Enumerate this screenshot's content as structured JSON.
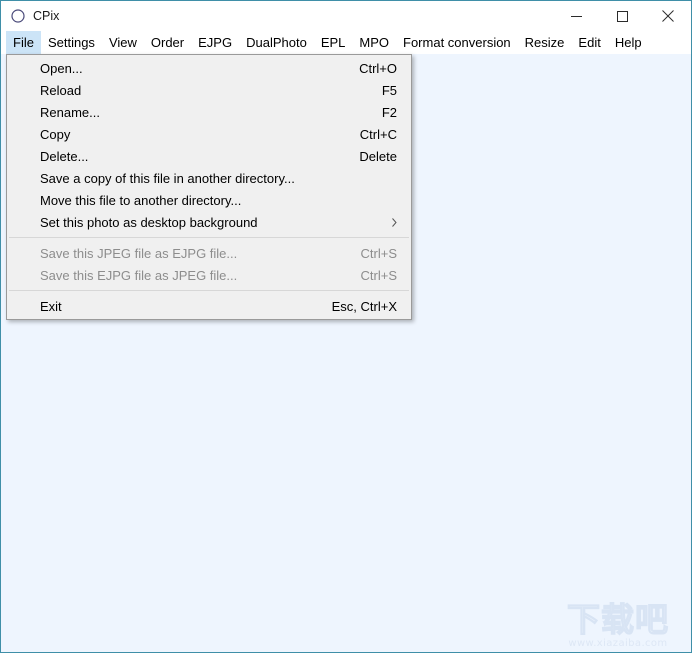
{
  "window": {
    "title": "CPix",
    "icon": "circle-outline-icon",
    "border_color": "#3f8fa8",
    "client_background": "#eef5fe",
    "controls": [
      {
        "name": "minimize",
        "glyph": "minimize-icon"
      },
      {
        "name": "maximize",
        "glyph": "maximize-icon"
      },
      {
        "name": "close",
        "glyph": "close-icon"
      }
    ]
  },
  "menubar": {
    "active_index": 0,
    "highlight_color": "#cce4f7",
    "items": [
      {
        "label": "File"
      },
      {
        "label": "Settings"
      },
      {
        "label": "View"
      },
      {
        "label": "Order"
      },
      {
        "label": "EJPG"
      },
      {
        "label": "DualPhoto"
      },
      {
        "label": "EPL"
      },
      {
        "label": "MPO"
      },
      {
        "label": "Format conversion"
      },
      {
        "label": "Resize"
      },
      {
        "label": "Edit"
      },
      {
        "label": "Help"
      }
    ]
  },
  "file_menu": {
    "background": "#f0f0f0",
    "items": [
      {
        "type": "item",
        "label": "Open...",
        "shortcut": "Ctrl+O",
        "enabled": true,
        "submenu": false
      },
      {
        "type": "item",
        "label": "Reload",
        "shortcut": "F5",
        "enabled": true,
        "submenu": false
      },
      {
        "type": "item",
        "label": "Rename...",
        "shortcut": "F2",
        "enabled": true,
        "submenu": false
      },
      {
        "type": "item",
        "label": "Copy",
        "shortcut": "Ctrl+C",
        "enabled": true,
        "submenu": false
      },
      {
        "type": "item",
        "label": "Delete...",
        "shortcut": "Delete",
        "enabled": true,
        "submenu": false
      },
      {
        "type": "item",
        "label": "Save a copy of this file in another directory...",
        "shortcut": "",
        "enabled": true,
        "submenu": false
      },
      {
        "type": "item",
        "label": "Move this file to another directory...",
        "shortcut": "",
        "enabled": true,
        "submenu": false
      },
      {
        "type": "item",
        "label": "Set this photo as desktop background",
        "shortcut": "",
        "enabled": true,
        "submenu": true
      },
      {
        "type": "separator"
      },
      {
        "type": "item",
        "label": "Save this JPEG file as EJPG file...",
        "shortcut": "Ctrl+S",
        "enabled": false,
        "submenu": false
      },
      {
        "type": "item",
        "label": "Save this EJPG file as JPEG file...",
        "shortcut": "Ctrl+S",
        "enabled": false,
        "submenu": false
      },
      {
        "type": "separator"
      },
      {
        "type": "item",
        "label": "Exit",
        "shortcut": "Esc, Ctrl+X",
        "enabled": true,
        "submenu": false
      }
    ]
  },
  "watermark": {
    "logo": "下载吧",
    "url": "www.xiazaiba.com"
  }
}
